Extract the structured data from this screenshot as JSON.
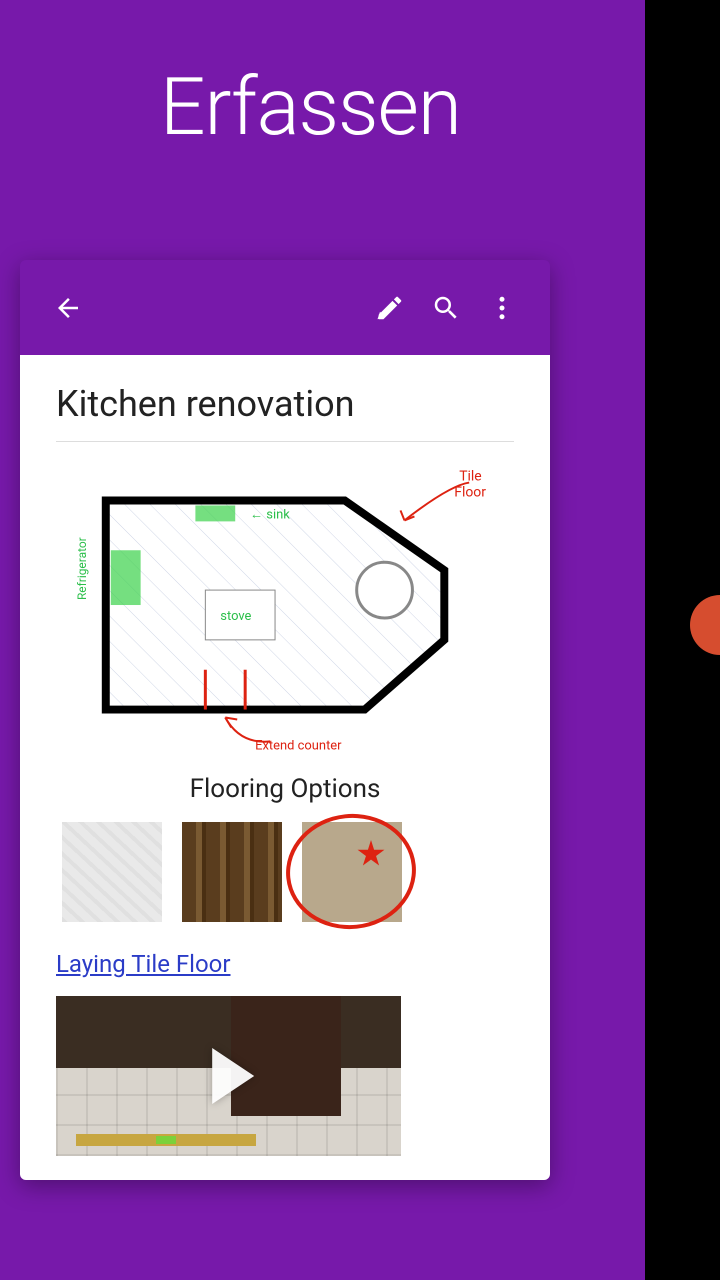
{
  "hero": {
    "title": "Erfassen"
  },
  "appbar": {
    "back_icon": "back",
    "pen_icon": "pen",
    "search_icon": "search",
    "more_icon": "more"
  },
  "note": {
    "title": "Kitchen renovation",
    "plan_annotations": {
      "tile_floor": "Tile Floor",
      "sink": "sink",
      "stove": "stove",
      "refrigerator": "Refrigerator",
      "extend_counter": "Extend counter"
    },
    "flooring_heading": "Flooring Options",
    "swatches": [
      "marble",
      "wood",
      "tile"
    ],
    "selected_swatch": "tile",
    "link_text": "Laying Tile Floor"
  }
}
